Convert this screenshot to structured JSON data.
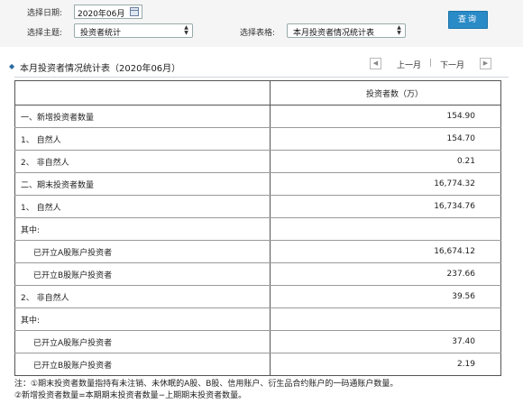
{
  "filters": {
    "date_label": "选择日期:",
    "date_value": "2020年06月",
    "topic_label": "选择主题:",
    "topic_value": "投资者统计",
    "table_label": "选择表格:",
    "table_value": "本月投资者情况统计表",
    "query_button": "查询"
  },
  "section": {
    "title": "本月投资者情况统计表（2020年06月）",
    "prev_label": "上一月",
    "next_label": "下一月",
    "separator": "|"
  },
  "table": {
    "header_value": "投资者数（万）",
    "rows": [
      {
        "name": "一、新增投资者数量",
        "value": "154.90"
      },
      {
        "name": "1、 自然人",
        "value": "154.70"
      },
      {
        "name": "2、 非自然人",
        "value": "0.21"
      },
      {
        "name": "二、期末投资者数量",
        "value": "16,774.32"
      },
      {
        "name": "1、 自然人",
        "value": "16,734.76"
      },
      {
        "name": "其中:",
        "value": ""
      },
      {
        "name": "已开立A股账户投资者",
        "value": "16,674.12"
      },
      {
        "name": "已开立B股账户投资者",
        "value": "237.66"
      },
      {
        "name": "2、 非自然人",
        "value": "39.56"
      },
      {
        "name": "其中:",
        "value": ""
      },
      {
        "name": "已开立A股账户投资者",
        "value": "37.40"
      },
      {
        "name": "已开立B股账户投资者",
        "value": "2.19"
      }
    ]
  },
  "notes": {
    "line1": "注：①期末投资者数量指持有未注销、未休眠的A股、B股、信用账户、衍生品合约账户的一码通账户数量。",
    "line2": "②新增投资者数量=本期期末投资者数量−上期期末投资者数量。"
  },
  "colors": {
    "accent": "#2a8bc7",
    "filter_bar_bg": "#f5f5f5"
  }
}
